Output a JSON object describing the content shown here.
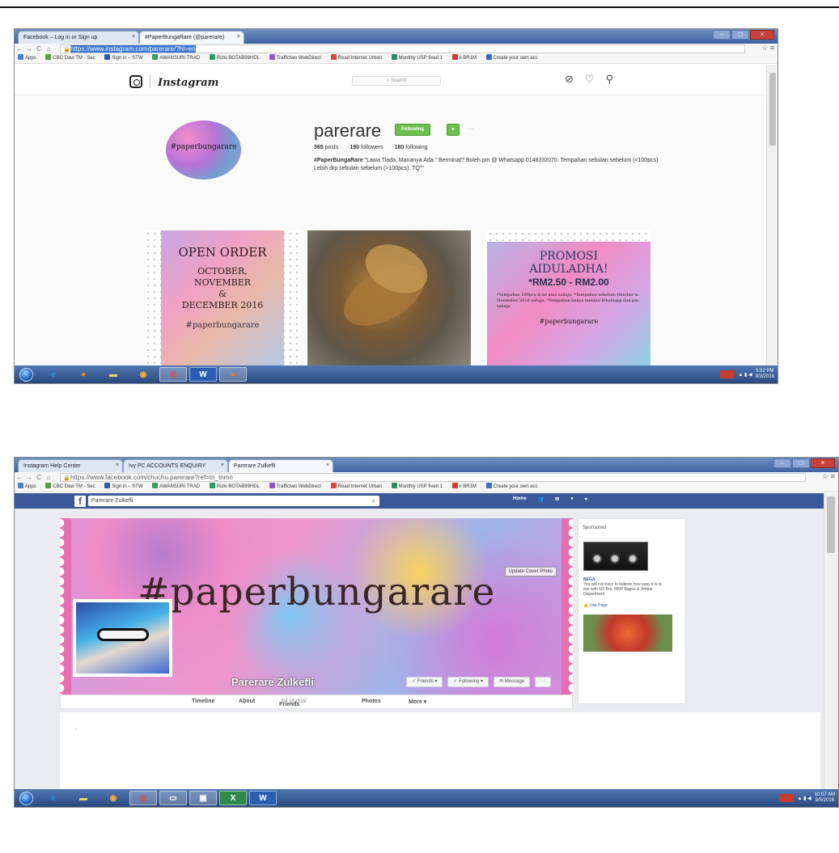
{
  "shot1": {
    "tabs": [
      {
        "label": "Facebook – Log in or Sign up"
      },
      {
        "label": "#PaperBungaRare (@parerare)"
      }
    ],
    "url": "https://www.instagram.com/parerare/?hl=en",
    "bookmarks": [
      "Apps",
      "CBC Daw TM - Sec",
      "Sign in – STW",
      "AWANSURI TRAD",
      "Rizki BOTAB99HDL",
      "Traffictwo WebDirect",
      "Road Internet Urban",
      "Monthly USP fixed 1",
      "x BR1M",
      "Create your own acc"
    ],
    "bookmark_colors": [
      "#4b7fd1",
      "#5a9c45",
      "#2c59a8",
      "#3a9d57",
      "#2c9a6a",
      "#8a5cc7",
      "#d94b3f",
      "#2d8a63",
      "#d9392c",
      "#3d6bc8"
    ],
    "instagram": {
      "wordmark": "Instagram",
      "search_placeholder": "Search",
      "icons": [
        "compass-icon",
        "heart-icon",
        "person-icon"
      ],
      "avatar_text": "#paperbungarare",
      "username": "parerare",
      "following_label": "Following",
      "dropdown_label": "▾",
      "more_label": "···",
      "posts_count": "365",
      "posts_label": "posts",
      "followers_count": "190",
      "followers_label": "followers",
      "following_count": "180",
      "following_label2": "following",
      "bio_name": "#PaperBungaRare",
      "bio_text": "\"Lawa Tiada, Mananya Ada.\" Berminat? Boleh pm @ Whatsapp 0148332070. Tempahan sebulan sebelum (<100pcs) Lebih drp sebulan sebelum (>100pcs). TQ\"\"",
      "post1": {
        "l1": "OPEN ORDER",
        "l2a": "OCTOBER,",
        "l2b": "NOVEMBER",
        "l2c": "&",
        "l2d": "DECEMBER 2016",
        "l3": "#paperbungarare"
      },
      "post3": {
        "t1": "PROMOSI",
        "t2": "AIDULADHA!",
        "t3": "*RM2.50 - RM2.00",
        "t4": "*Tempahan 100pcs & ke atas sahaja. *Tempahan sebelum Oktober & November 2016 sahaja. *Tempahan hanya melalui Whatsapp dan pm sahaja.",
        "t5": "#paperbungarare"
      }
    },
    "taskbar_apps": [
      "ie",
      "firefox",
      "explorer",
      "media",
      "chrome",
      "W",
      "ff"
    ],
    "clock": {
      "time": "5:52 PM",
      "date": "9/3/2016"
    }
  },
  "shot2": {
    "tabs": [
      {
        "label": "Instagram Help Center"
      },
      {
        "label": "Ivy PC ACCOUNTS ENQUIRY"
      },
      {
        "label": "Parerare Zulkefli"
      }
    ],
    "url": "https://www.facebook.com/chuchu.parerare?ref=tn_tnmn",
    "bookmarks": [
      "Apps",
      "CBC Daw TM - Sec",
      "Sign in – STW",
      "AWANSURI TRAD",
      "Rizki BOTAB99HDL",
      "Traffictwo WebDirect",
      "Road Internet Urban",
      "Monthly USP fixed 1",
      "x BR1M",
      "Create your own acc"
    ],
    "facebook": {
      "logo": "f",
      "search_value": "Parerare Zulkefli",
      "nav_home": "Home",
      "cover_text": "#paperbungarare",
      "update_cover": "Update Cover Photo",
      "name": "Parerare Zulkefli",
      "btn_friends": "✓ Friends ▾",
      "btn_following": "✓ Following ▾",
      "btn_message": "✉ Message",
      "btn_more": "···",
      "tab_timeline": "Timeline",
      "tab_about": "About",
      "tab_friends": "Friends",
      "tab_friends_count": "84 Mutual",
      "tab_photos": "Photos",
      "tab_more": "More ▾",
      "sponsored": "Sponsored",
      "ad_title": "BEGA",
      "ad_text": "You will not have to believe how easy it is to win with 5/5 Bra, MRP Bagus & Jimbai Department",
      "ad_like": "Like Page"
    },
    "clock": {
      "time": "10:07 AM",
      "date": "9/5/2016"
    }
  }
}
